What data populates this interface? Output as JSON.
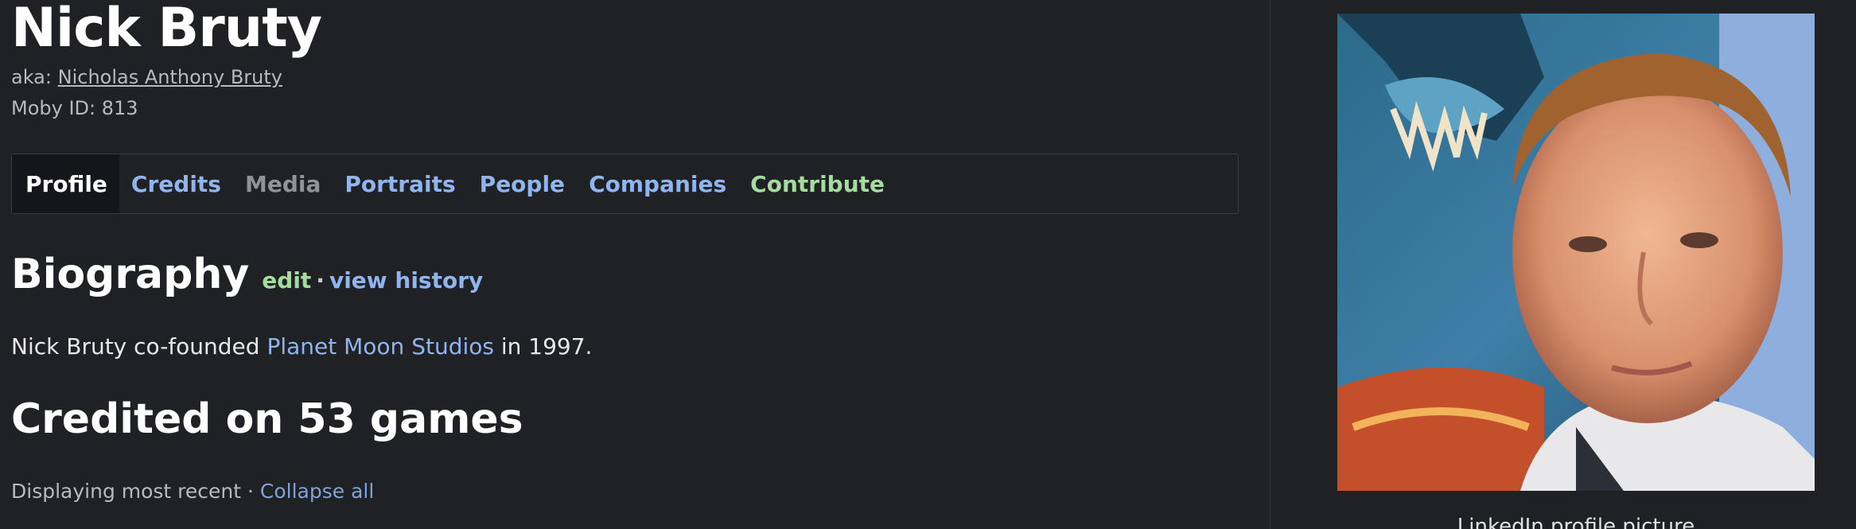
{
  "person": {
    "name": "Nick Bruty",
    "aka_label": "aka:",
    "aka_name": "Nicholas Anthony Bruty",
    "moby_id": "Moby ID: 813"
  },
  "tabs": [
    {
      "label": "Profile",
      "state": "active"
    },
    {
      "label": "Credits",
      "state": "link"
    },
    {
      "label": "Media",
      "state": "muted"
    },
    {
      "label": "Portraits",
      "state": "link"
    },
    {
      "label": "People",
      "state": "link"
    },
    {
      "label": "Companies",
      "state": "link"
    },
    {
      "label": "Contribute",
      "state": "green"
    }
  ],
  "biography": {
    "heading": "Biography",
    "edit_label": "edit",
    "separator": "·",
    "history_label": "view history",
    "text_before": "Nick Bruty co-founded ",
    "studio_link": "Planet Moon Studios",
    "text_after": " in 1997."
  },
  "credits": {
    "heading": "Credited on 53 games",
    "display_text": "Displaying most recent · ",
    "collapse_label": "Collapse all"
  },
  "portrait": {
    "caption": "LinkedIn profile picture"
  },
  "colors": {
    "background": "#202125",
    "link_blue": "#8fb4ee",
    "contribute_green": "#a6dba0",
    "muted_gray": "#929396"
  }
}
